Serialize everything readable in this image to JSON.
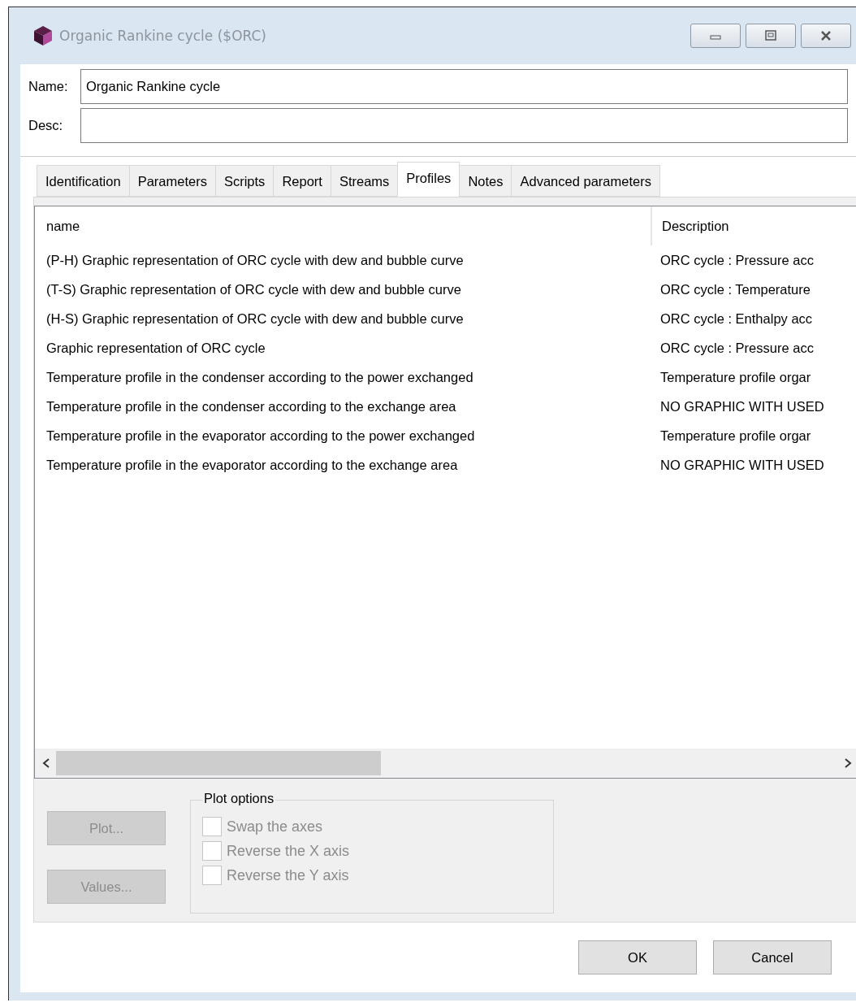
{
  "window": {
    "title": "Organic Rankine cycle ($ORC)"
  },
  "fields": [
    {
      "label": "Name:",
      "value": "Organic Rankine cycle"
    },
    {
      "label": "Desc:"
    }
  ],
  "tabs": [
    {
      "label": "Identification",
      "selected": false
    },
    {
      "label": "Parameters",
      "selected": false
    },
    {
      "label": "Scripts",
      "selected": false
    },
    {
      "label": "Report",
      "selected": false
    },
    {
      "label": "Streams",
      "selected": false
    },
    {
      "label": "Profiles",
      "selected": true
    },
    {
      "label": "Notes",
      "selected": false
    },
    {
      "label": "Advanced parameters",
      "selected": false
    }
  ],
  "table": {
    "columns": [
      "name",
      "Description"
    ],
    "rows": [
      [
        "(P-H) Graphic representation of ORC cycle with dew and bubble curve",
        "ORC cycle : Pressure acc"
      ],
      [
        "(T-S) Graphic representation of ORC cycle with dew and bubble curve",
        "ORC cycle : Temperature"
      ],
      [
        "(H-S) Graphic representation of ORC cycle with dew and bubble curve",
        "ORC cycle : Enthalpy acc"
      ],
      [
        "Graphic representation of ORC cycle",
        "ORC cycle : Pressure acc"
      ],
      [
        "Temperature profile in the condenser according to the power exchanged",
        "Temperature profile orgar"
      ],
      [
        "Temperature profile in the condenser according to the exchange area",
        "NO GRAPHIC WITH USED"
      ],
      [
        "Temperature profile in the evaporator according to the power exchanged",
        "Temperature profile orgar"
      ],
      [
        "Temperature profile in the evaporator according to the exchange area",
        "NO GRAPHIC WITH USED"
      ]
    ]
  },
  "actions": [
    {
      "label": "Plot...",
      "disabled": true
    },
    {
      "label": "Values...",
      "disabled": true
    }
  ],
  "plot_options": {
    "title": "Plot options",
    "options": [
      {
        "label": "Swap the axes",
        "checked": false,
        "disabled": true
      },
      {
        "label": "Reverse the X axis",
        "checked": false,
        "disabled": true
      },
      {
        "label": "Reverse the Y axis",
        "checked": false,
        "disabled": true
      }
    ]
  },
  "buttons": [
    "OK",
    "Cancel"
  ]
}
